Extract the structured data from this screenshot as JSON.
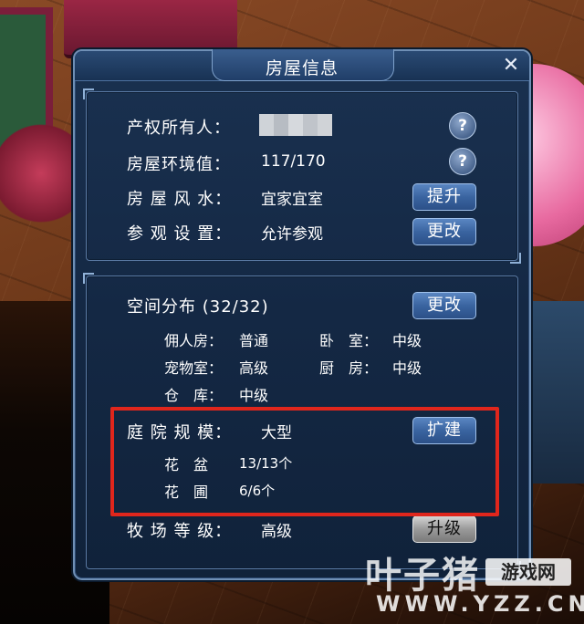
{
  "window": {
    "title": "房屋信息",
    "close_glyph": "✕"
  },
  "info": {
    "owner_label": "产权所有人：",
    "env_label": "房屋环境值：",
    "env_value": "117/170",
    "fengshui_label": "房 屋 风 水：",
    "fengshui_value": "宜家宜室",
    "visit_label": "参 观 设 置：",
    "visit_value": "允许参观",
    "help_glyph": "?",
    "upgrade_btn": "提升",
    "change_btn": "更改"
  },
  "space": {
    "title": "空间分布 (32/32)",
    "change_btn": "更改",
    "rooms": [
      {
        "name": "佣人房：",
        "level": "普通"
      },
      {
        "name": "卧　室：",
        "level": "中级"
      },
      {
        "name": "宠物室：",
        "level": "高级"
      },
      {
        "name": "厨　房：",
        "level": "中级"
      },
      {
        "name": "仓　库：",
        "level": "中级"
      }
    ]
  },
  "yard": {
    "label": "庭 院 规 模：",
    "value": "大型",
    "expand_btn": "扩建",
    "items": [
      {
        "name": "花　盆",
        "count": "13/13个"
      },
      {
        "name": "花　圃",
        "count": "6/6个"
      }
    ]
  },
  "ranch": {
    "label": "牧 场 等 级：",
    "value": "高级",
    "upgrade_btn": "升级"
  },
  "watermark": {
    "brand": "叶子猪",
    "tag": "游戏网",
    "url": "WWW.YZZ.CN"
  },
  "colors": {
    "highlight": "#e0261c",
    "panel": "#142844",
    "button": "#3a64a0"
  }
}
